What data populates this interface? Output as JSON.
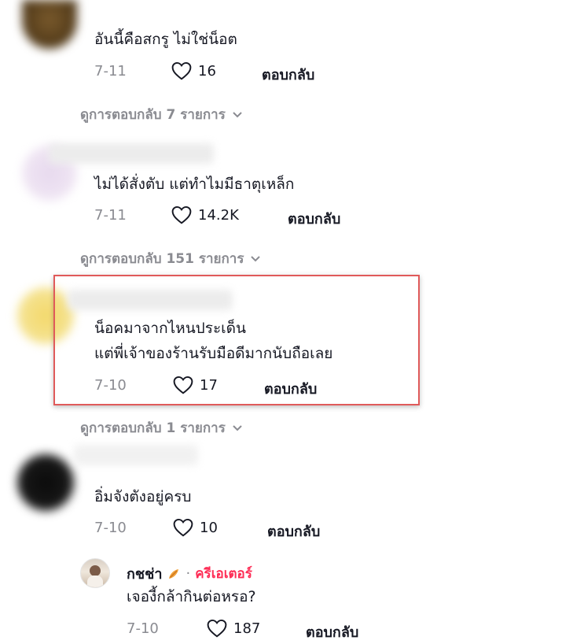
{
  "comments": [
    {
      "text_lines": [
        "อันนี้คือสกรู ไม่ใช่น็อต"
      ],
      "date": "7-11",
      "likes": "16",
      "reply_label": "ตอบกลับ",
      "view_replies": "ดูการตอบกลับ 7 รายการ"
    },
    {
      "text_lines": [
        "ไม่ได้สั่งตับ แต่ทำไมมีธาตุเหล็ก"
      ],
      "date": "7-11",
      "likes": "14.2K",
      "reply_label": "ตอบกลับ",
      "view_replies": "ดูการตอบกลับ 151 รายการ"
    },
    {
      "text_lines": [
        "น็อคมาจากไหนประเด็น",
        "แต่พี่เจ้าของร้านรับมือดีมากนับถือเลย"
      ],
      "date": "7-10",
      "likes": "17",
      "reply_label": "ตอบกลับ",
      "view_replies": "ดูการตอบกลับ 1 รายการ",
      "highlighted": true
    },
    {
      "text_lines": [
        "อิ่มจังตังอยู่ครบ"
      ],
      "date": "7-10",
      "likes": "10",
      "reply_label": "ตอบกลับ"
    }
  ],
  "reply": {
    "username": "กชช่า",
    "separator": "·",
    "creator_label": "ครีเอเตอร์",
    "text": "เจองี้กล้ากินต่อหรอ?",
    "date": "7-10",
    "likes": "187",
    "reply_label": "ตอบกลับ"
  },
  "colors": {
    "highlight_border": "#e05a5a",
    "creator_accent": "#fe2c55",
    "muted_text": "#8a8b91"
  },
  "icons": {
    "like": "heart-outline-icon",
    "expand": "chevron-down-icon",
    "badge": "creator-badge-icon"
  }
}
